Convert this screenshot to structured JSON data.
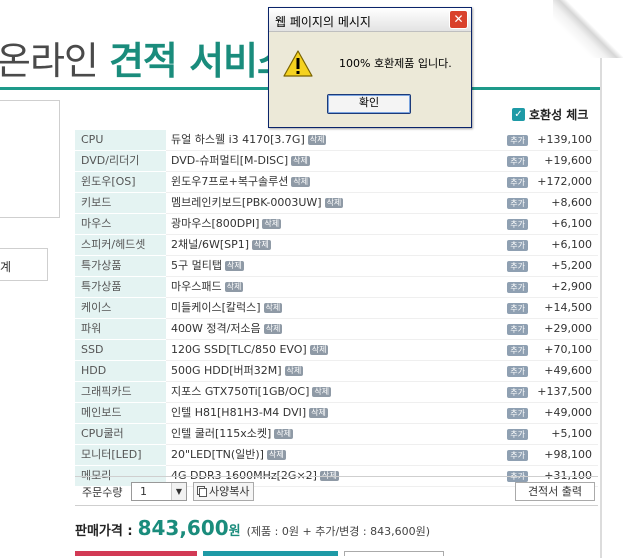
{
  "header": {
    "title_part1": "온라인 ",
    "title_part2": "견적 서비스"
  },
  "left_panel": {
    "box2_text": "계"
  },
  "compat_check": {
    "label": "호환성 체크",
    "checked": true
  },
  "badges": {
    "delete_label": "삭제",
    "add_label": "추가"
  },
  "items": [
    {
      "category": "CPU",
      "name": "듀얼 하스웰 i3 4170[3.7G]",
      "price": "+139,100"
    },
    {
      "category": "DVD/리더기",
      "name": "DVD-슈퍼멀티[M-DISC]",
      "price": "+19,600"
    },
    {
      "category": "윈도우[OS]",
      "name": "윈도우7프로+복구솔루션",
      "price": "+172,000"
    },
    {
      "category": "키보드",
      "name": "멤브레인키보드[PBK-0003UW]",
      "price": "+8,600"
    },
    {
      "category": "마우스",
      "name": "광마우스[800DPI]",
      "price": "+6,100"
    },
    {
      "category": "스피커/헤드셋",
      "name": "2채널/6W[SP1]",
      "price": "+6,100"
    },
    {
      "category": "특가상품",
      "name": "5구 멀티탭",
      "price": "+5,200"
    },
    {
      "category": "특가상품",
      "name": "마우스패드",
      "price": "+2,900"
    },
    {
      "category": "케이스",
      "name": "미들케이스[칼럭스]",
      "price": "+14,500"
    },
    {
      "category": "파워",
      "name": "400W 정격/저소음",
      "price": "+29,000"
    },
    {
      "category": "SSD",
      "name": "120G SSD[TLC/850 EVO]",
      "price": "+70,100"
    },
    {
      "category": "HDD",
      "name": "500G HDD[버퍼32M]",
      "price": "+49,600"
    },
    {
      "category": "그래픽카드",
      "name": "지포스 GTX750Ti[1GB/OC]",
      "price": "+137,500"
    },
    {
      "category": "메인보드",
      "name": "인텔 H81[H81H3-M4 DVI]",
      "price": "+49,000"
    },
    {
      "category": "CPU쿨러",
      "name": "인텔 쿨러[115x소켓]",
      "price": "+5,100"
    },
    {
      "category": "모니터[LED]",
      "name": "20\"LED[TN(일반)]",
      "price": "+98,100"
    },
    {
      "category": "메모리",
      "name": "4G DDR3 1600MHz[2G×2]",
      "price": "+31,100"
    }
  ],
  "quantity": {
    "label": "주문수량",
    "value": "1",
    "copy_label": "사양복사",
    "print_label": "견적서 출력"
  },
  "total": {
    "label": "판매가격 :",
    "amount": "843,600",
    "currency": "원",
    "detail": "(제품 : 0원 + 추가/변경 : 843,600원)"
  },
  "dialog": {
    "title": "웹 페이지의 메시지",
    "message": "100% 호환제품 입니다.",
    "ok_label": "확인",
    "close_glyph": "✕"
  },
  "colors": {
    "accent": "#1a8c7c",
    "category_bg": "#e4f3f2",
    "dialog_bg": "#ece9d8",
    "close_red": "#d9412b"
  }
}
